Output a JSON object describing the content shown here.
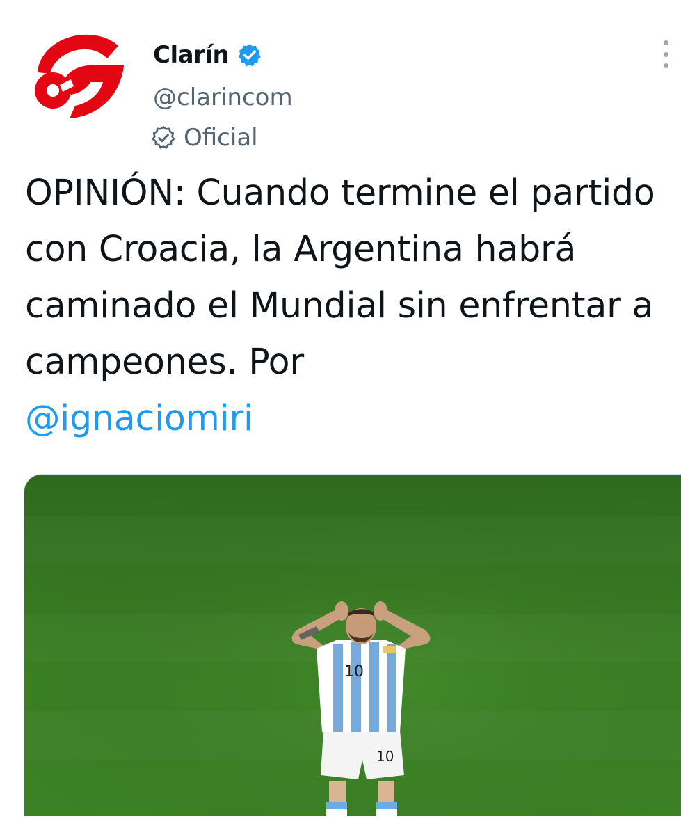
{
  "account": {
    "display_name": "Clarín",
    "handle": "@clarincom",
    "label": "Oficial",
    "logo_color": "#e30613",
    "verified_color": "#1d9bf0"
  },
  "tweet": {
    "text": "OPINIÓN: Cuando termine el partido con Croacia, la Argentina habrá caminado el Mundial sin enfrentar a campeones. Por",
    "mention": "@ignaciomiri",
    "link_color": "#1d9bf0"
  },
  "media": {
    "jersey_number": "10"
  },
  "icons": {
    "verified": "verified-badge-icon",
    "label": "official-label-icon",
    "more": "more-options-icon"
  }
}
